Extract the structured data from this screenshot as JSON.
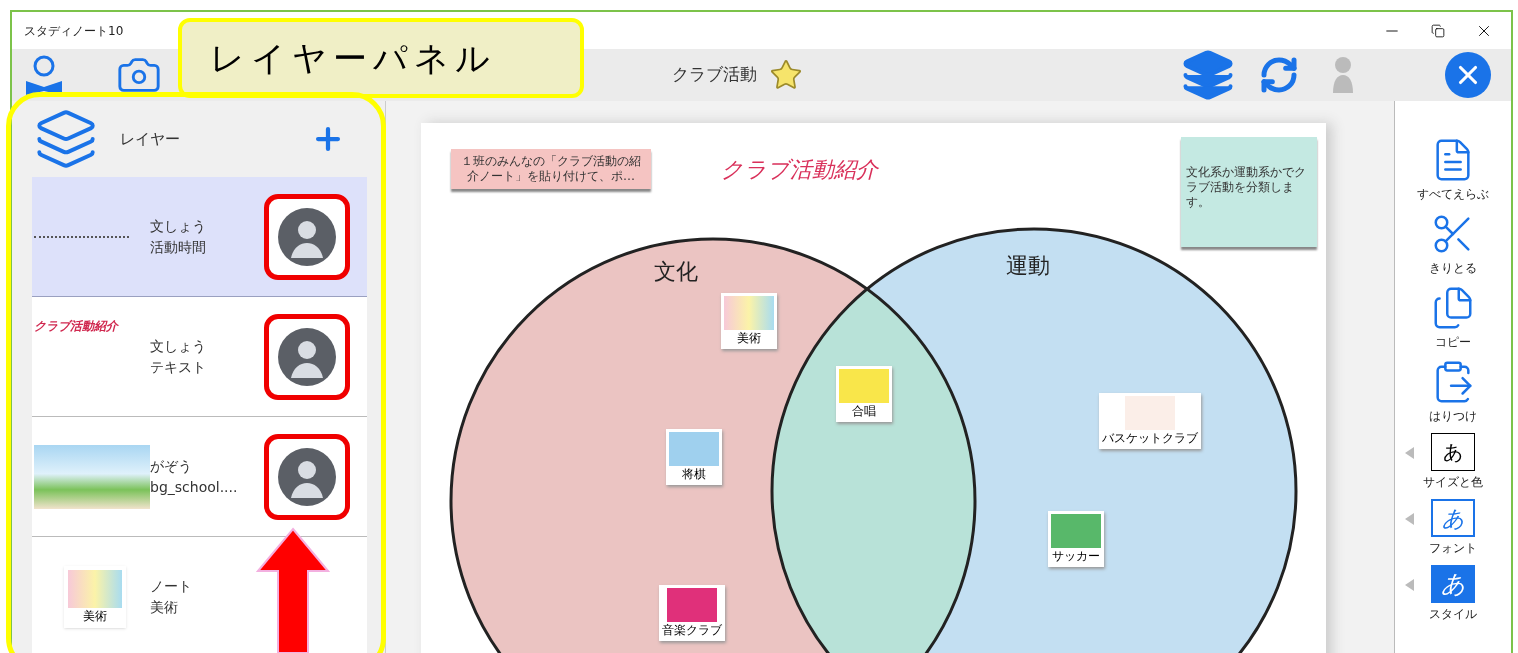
{
  "window": {
    "title": "スタディノート10"
  },
  "callout": {
    "text": "レイヤーパネル"
  },
  "toolbar": {
    "document_title": "クラブ活動",
    "favorite": true
  },
  "layer_panel": {
    "title": "レイヤー",
    "layers": [
      {
        "kind": "text",
        "type_label": "文しょう",
        "name": "活動時間",
        "selected": true,
        "highlighted": true,
        "has_avatar": true
      },
      {
        "kind": "title",
        "type_label": "文しょう",
        "name": "テキスト",
        "preview": "クラブ活動紹介",
        "selected": false,
        "highlighted": true,
        "has_avatar": true
      },
      {
        "kind": "image",
        "type_label": "がぞう",
        "name": "bg_school....",
        "selected": false,
        "highlighted": true,
        "has_avatar": true
      },
      {
        "kind": "note",
        "type_label": "ノート",
        "name": "美術",
        "preview": "美術",
        "selected": false,
        "highlighted": false,
        "has_avatar": false
      }
    ]
  },
  "canvas": {
    "title": "クラブ活動紹介",
    "notes": [
      {
        "text": "１班のみんなの「クラブ活動の紹介ノート」を貼り付けて、ポ…",
        "color": "#f5c4c2"
      },
      {
        "text": "文化系か運動系かでクラブ活動を分類します。",
        "color": "#c4e9e2"
      }
    ],
    "venn": [
      {
        "label": "文化",
        "color": "#ebc4c2"
      },
      {
        "label": "運動",
        "color": "#c3dff2"
      }
    ],
    "cards": [
      {
        "label": "美術",
        "kind": "gradient"
      },
      {
        "label": "合唱",
        "kind": "yellow"
      },
      {
        "label": "将棋",
        "kind": "photo"
      },
      {
        "label": "バスケットクラブ",
        "kind": "ball"
      },
      {
        "label": "サッカー",
        "kind": "green"
      },
      {
        "label": "音楽クラブ",
        "kind": "pink"
      }
    ]
  },
  "tools": [
    {
      "label": "すべてえらぶ",
      "kind": "select_all",
      "has_submenu": false
    },
    {
      "label": "きりとる",
      "kind": "cut",
      "has_submenu": false
    },
    {
      "label": "コピー",
      "kind": "copy",
      "has_submenu": false
    },
    {
      "label": "はりつけ",
      "kind": "paste",
      "has_submenu": false
    },
    {
      "label": "サイズと色",
      "kind": "size_color",
      "glyph": "あ",
      "has_submenu": true
    },
    {
      "label": "フォント",
      "kind": "font",
      "glyph": "あ",
      "has_submenu": true
    },
    {
      "label": "スタイル",
      "kind": "style",
      "glyph": "あ",
      "has_submenu": true
    }
  ]
}
